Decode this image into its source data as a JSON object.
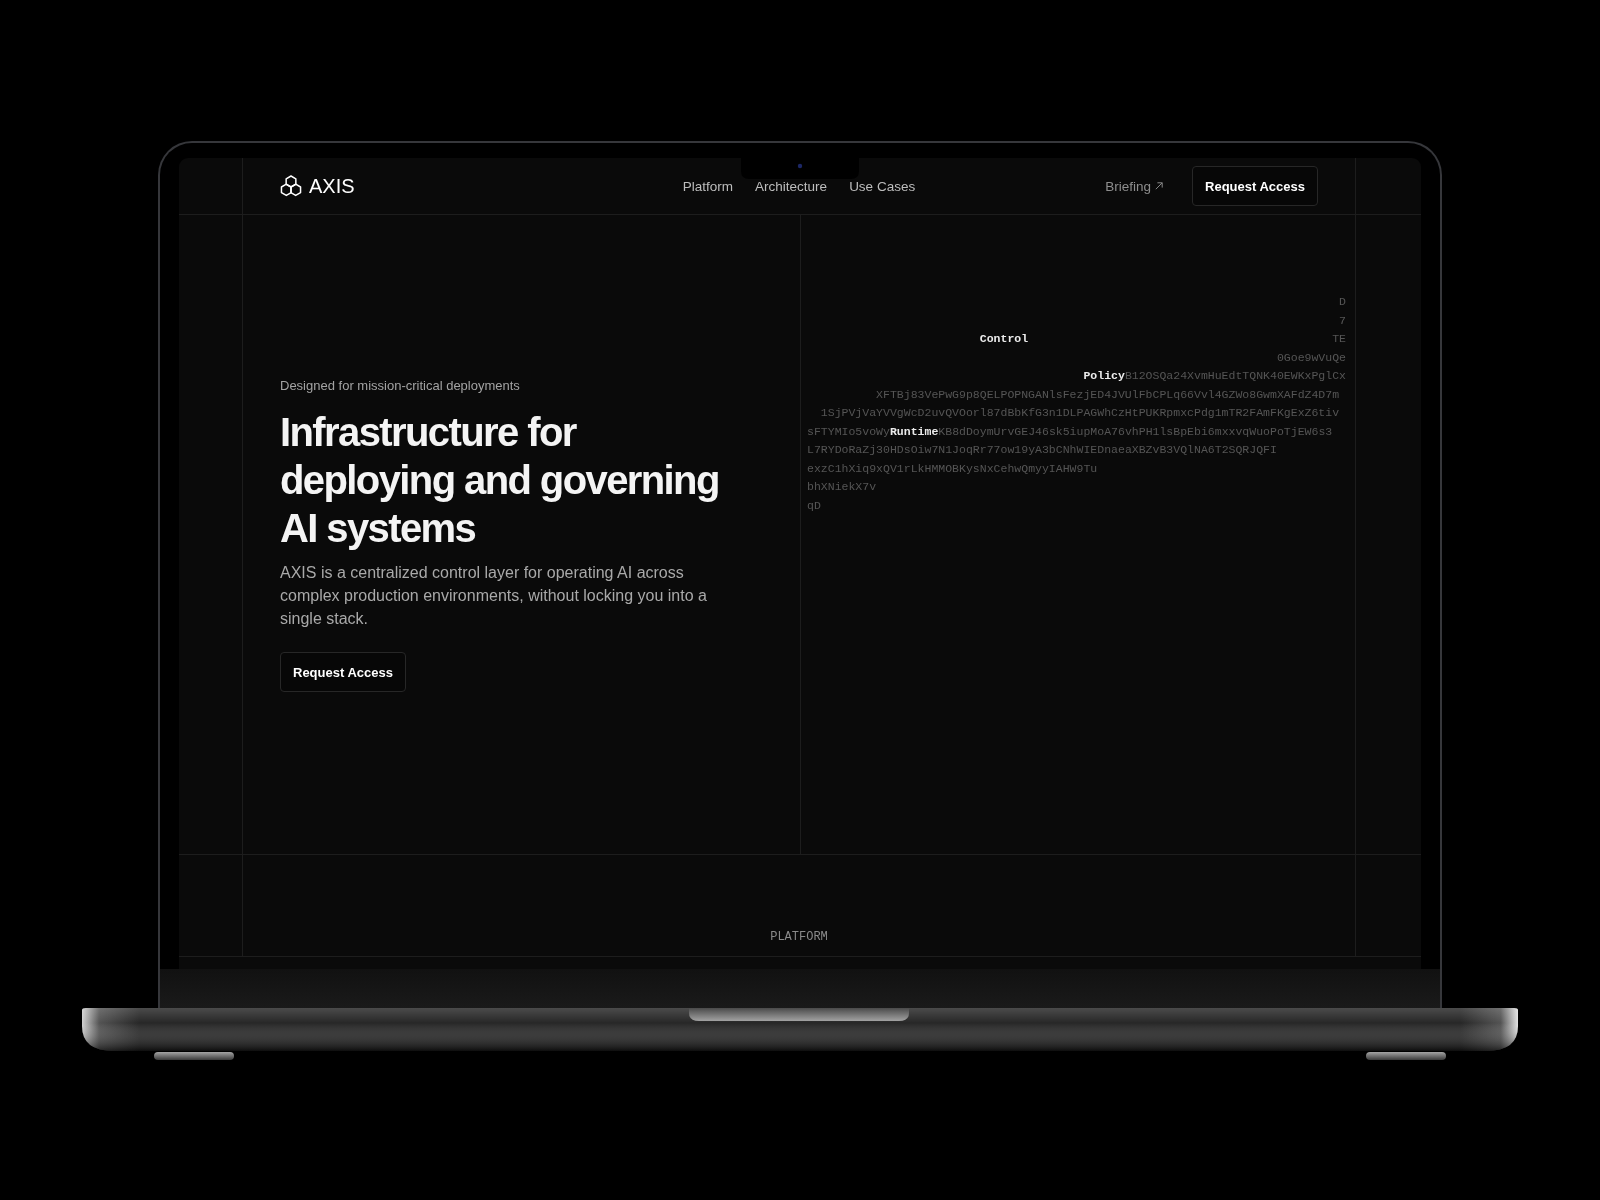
{
  "nav": {
    "brand": "AXIS",
    "links": [
      "Platform",
      "Architecture",
      "Use Cases"
    ],
    "briefing_link": {
      "label": "Briefing",
      "external": true
    },
    "cta": "Request Access"
  },
  "hero": {
    "eyebrow": "Designed for mission-critical deployments",
    "title": "Infrastructure for deploying and governing AI systems",
    "description": "AXIS is a centralized control layer for operating AI across complex production environments, without locking you into a single stack.",
    "cta": "Request Access"
  },
  "hero_graphic": {
    "lines": [
      "                                                                             D",
      "                                                                             7",
      "                         **Control**                                            TE",
      "                                                                    0Goe9wVuQe",
      "                                        **Policy**B12OSQa24XvmHuEdtTQNK40EWKxPglCx",
      "          XFTBj83VePwG9p8QELPOPNGANlsFezjED4JVUlFbCPLq66Vvl4GZWo8GwmXAFdZ4D7m",
      "  1SjPVjVaYVVgWcD2uvQVOorl87dBbKfG3n1DLPAGWhCzHtPUKRpmxcPdg1mTR2FAmFKgExZ6tiv",
      "sFTYMIo5voWy**Runtime**KB8dDoymUrvGEJ46sk5iupMoA76vhPH1lsBpEbi6mxxvqWuoPoTjEW6s3",
      "L7RYDoRaZj30HDsOiw7N1JoqRr77ow19yA3bCNhWIEDnaeaXBZvB3VQlNA6T2SQRJQFI",
      "exzC1hXiq9xQV1rLkHMMOBKysNxCehwQmyyIAHW9Tu",
      "bhXNiekX7v",
      "qD"
    ]
  },
  "next_section": {
    "label": "PLATFORM"
  }
}
